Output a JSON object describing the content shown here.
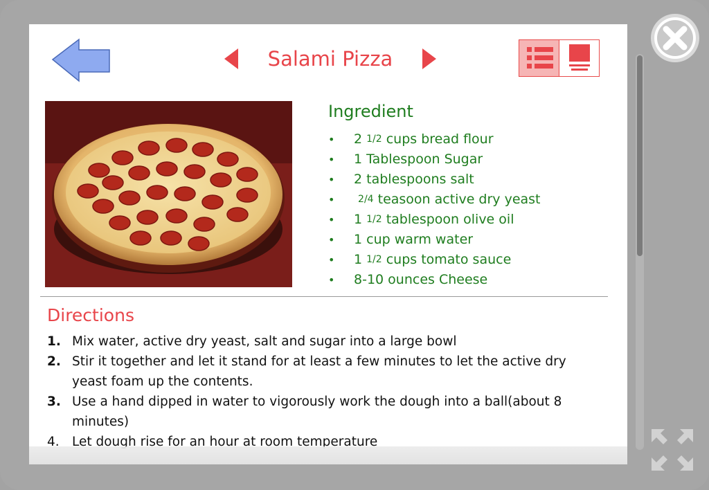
{
  "header": {
    "title": "Salami Pizza",
    "back_icon": "back-arrow-icon",
    "prev_icon": "triangle-left-icon",
    "next_icon": "triangle-right-icon",
    "view_list_icon": "list-view-icon",
    "view_page_icon": "page-view-icon"
  },
  "ingredients": {
    "title": "Ingredient",
    "items": [
      {
        "qty": "2",
        "frac": "1/2",
        "text": "cups bread flour"
      },
      {
        "qty": "1",
        "frac": "",
        "text": "Tablespoon Sugar"
      },
      {
        "qty": "2",
        "frac": "",
        "text": "tablespoons salt"
      },
      {
        "qty": "",
        "frac": "2/4",
        "text": "teasoon active dry yeast"
      },
      {
        "qty": "1",
        "frac": "1/2",
        "text": "tablespoon olive oil"
      },
      {
        "qty": "1",
        "frac": "",
        "text": "cup warm water"
      },
      {
        "qty": "1",
        "frac": "1/2",
        "text": "cups tomato sauce"
      },
      {
        "qty": "8-10",
        "frac": "",
        "text": "ounces Cheese"
      }
    ]
  },
  "directions": {
    "title": "Directions",
    "steps": [
      {
        "num": "1.",
        "text": "Mix water, active dry yeast, salt and sugar into a large bowl"
      },
      {
        "num": "2.",
        "text": "Stir it together and let it stand for at least a few minutes to let the active dry yeast foam up the contents."
      },
      {
        "num": "3.",
        "text": "Use a hand dipped in water to vigorously work the dough into a ball(about 8 minutes)"
      },
      {
        "num": "4.",
        "text": "Let dough rise for an hour at room temperature"
      }
    ]
  },
  "chrome": {
    "close_icon": "close-icon",
    "expand_icon": "expand-icon"
  },
  "colors": {
    "accent_red": "#e8454a",
    "ingredient_green": "#1f7d1f",
    "back_arrow_blue": "#8eaaf0"
  }
}
